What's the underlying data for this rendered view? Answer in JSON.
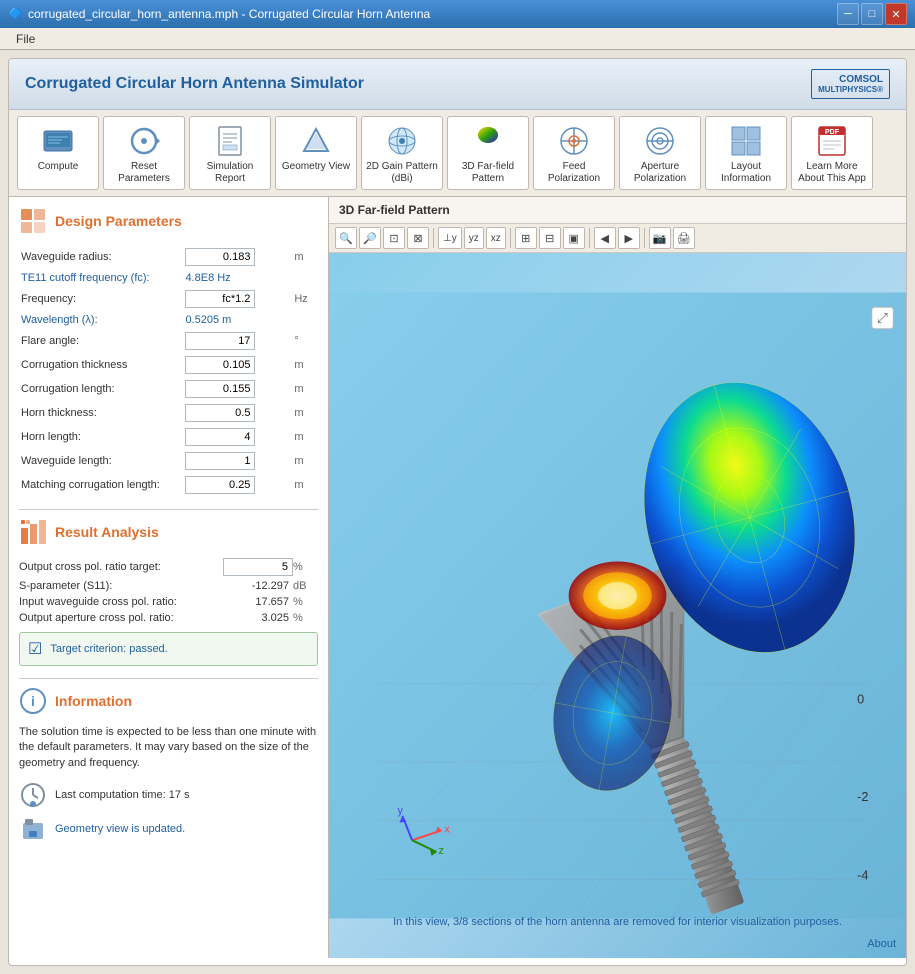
{
  "window": {
    "title": "corrugated_circular_horn_antenna.mph - Corrugated Circular Horn Antenna",
    "icon": "🔷"
  },
  "menu": {
    "items": [
      "File"
    ]
  },
  "app_header": {
    "title": "Corrugated Circular Horn Antenna Simulator",
    "logo_line1": "COMSOL",
    "logo_line2": "MULTIPHYSICS®"
  },
  "toolbar": {
    "buttons": [
      {
        "id": "compute",
        "label": "Compute",
        "icon": "📊"
      },
      {
        "id": "reset-params",
        "label": "Reset Parameters",
        "icon": "🔄"
      },
      {
        "id": "sim-report",
        "label": "Simulation Report",
        "icon": "📋"
      },
      {
        "id": "geometry-view",
        "label": "Geometry View",
        "icon": "▷"
      },
      {
        "id": "2d-gain",
        "label": "2D Gain Pattern (dBi)",
        "icon": "🔵"
      },
      {
        "id": "3d-farfield",
        "label": "3D Far-field Pattern",
        "icon": "🎨"
      },
      {
        "id": "feed-polar",
        "label": "Feed Polarization",
        "icon": "⊕"
      },
      {
        "id": "aperture-polar",
        "label": "Aperture Polarization",
        "icon": "⊙"
      },
      {
        "id": "layout-info",
        "label": "Layout Information",
        "icon": "⊞"
      },
      {
        "id": "learn-more",
        "label": "Learn More About This App",
        "icon": "📄"
      }
    ]
  },
  "design_params": {
    "section_title": "Design Parameters",
    "params": [
      {
        "label": "Waveguide radius:",
        "value": "0.183",
        "unit": "m",
        "type": "input"
      },
      {
        "label": "TE11 cutoff frequency (fc):",
        "value": "4.8E8 Hz",
        "unit": "",
        "type": "link"
      },
      {
        "label": "Frequency:",
        "value": "fc*1.2",
        "unit": "Hz",
        "type": "input"
      },
      {
        "label": "Wavelength (λ):",
        "value": "0.5205 m",
        "unit": "",
        "type": "link"
      },
      {
        "label": "Flare angle:",
        "value": "17",
        "unit": "°",
        "type": "input"
      },
      {
        "label": "Corrugation thickness",
        "value": "0.105",
        "unit": "m",
        "type": "input"
      },
      {
        "label": "Corrugation length:",
        "value": "0.155",
        "unit": "m",
        "type": "input"
      },
      {
        "label": "Horn thickness:",
        "value": "0.5",
        "unit": "m",
        "type": "input"
      },
      {
        "label": "Horn length:",
        "value": "4",
        "unit": "m",
        "type": "input"
      },
      {
        "label": "Waveguide length:",
        "value": "1",
        "unit": "m",
        "type": "input"
      },
      {
        "label": "Matching corrugation length:",
        "value": "0.25",
        "unit": "m",
        "type": "input"
      }
    ]
  },
  "result_analysis": {
    "section_title": "Result Analysis",
    "rows": [
      {
        "label": "Output cross pol. ratio target:",
        "value": "5",
        "unit": "%",
        "type": "input"
      },
      {
        "label": "S-parameter (S11):",
        "value": "-12.297",
        "unit": "dB",
        "type": "value"
      },
      {
        "label": "Input waveguide cross pol. ratio:",
        "value": "17.657",
        "unit": "%",
        "type": "value"
      },
      {
        "label": "Output aperture cross pol. ratio:",
        "value": "3.025",
        "unit": "%",
        "type": "value"
      }
    ],
    "target_criterion": "Target criterion: passed."
  },
  "information": {
    "section_title": "Information",
    "text": "The solution time is expected to be less than one minute with the default parameters. It may vary based on the size of the geometry and frequency.",
    "last_computation": "Last computation time: 17 s",
    "geometry_status": "Geometry view is updated."
  },
  "view": {
    "title": "3D Far-field Pattern",
    "caption": "In this view, 3/8 sections of the horn antenna are removed for interior visualization purposes.",
    "about_link": "About"
  },
  "colors": {
    "accent": "#e07030",
    "link": "#2060a0",
    "bg": "#e8e4dc"
  }
}
